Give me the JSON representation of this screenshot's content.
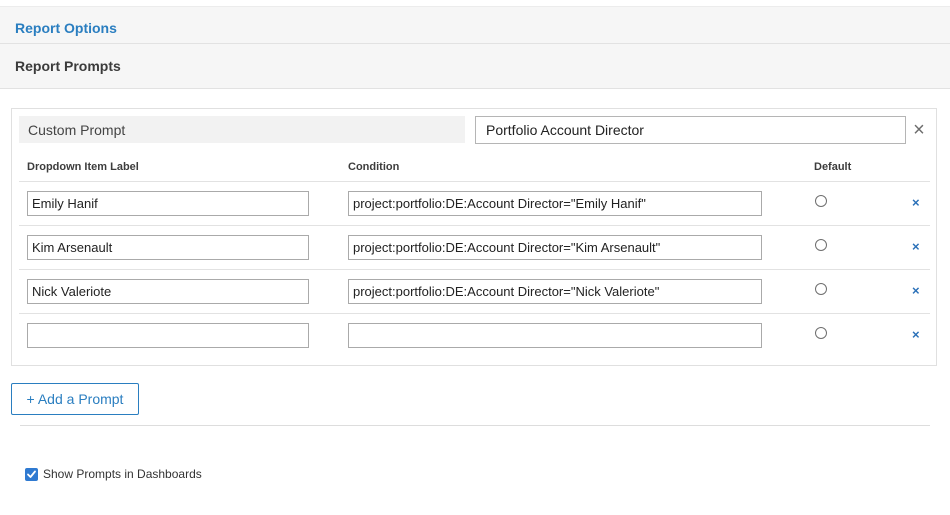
{
  "sections": {
    "report_options": "Report Options",
    "report_prompts": "Report Prompts"
  },
  "prompt": {
    "type_label": "Custom Prompt",
    "name_value": "Portfolio Account Director",
    "remove_icon": "close-icon",
    "columns": {
      "label": "Dropdown Item Label",
      "condition": "Condition",
      "default": "Default"
    },
    "rows": [
      {
        "label": "Emily Hanif",
        "condition": "project:portfolio:DE:Account Director=\"Emily Hanif\"",
        "default": false
      },
      {
        "label": "Kim Arsenault",
        "condition": "project:portfolio:DE:Account Director=\"Kim Arsenault\"",
        "default": false
      },
      {
        "label": "Nick Valeriote",
        "condition": "project:portfolio:DE:Account Director=\"Nick Valeriote\"",
        "default": false
      },
      {
        "label": "",
        "condition": "",
        "default": false
      }
    ]
  },
  "add_prompt_label": "+ Add a Prompt",
  "show_prompts": {
    "label": "Show Prompts in Dashboards",
    "checked": true
  },
  "colors": {
    "accent": "#2a7ec0",
    "checkbox": "#2f7ad1"
  }
}
